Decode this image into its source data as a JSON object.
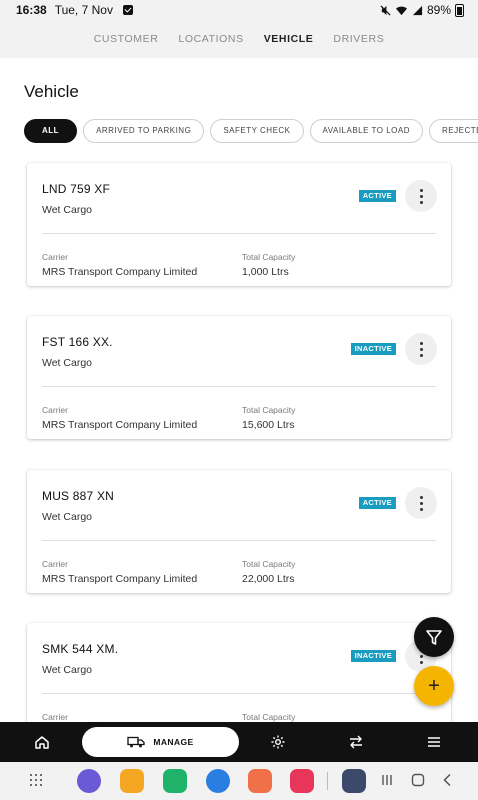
{
  "status_bar": {
    "time": "16:38",
    "date": "Tue, 7 Nov",
    "battery": "89%"
  },
  "top_tabs": [
    {
      "label": "CUSTOMER",
      "active": false
    },
    {
      "label": "LOCATIONS",
      "active": false
    },
    {
      "label": "VEHICLE",
      "active": true
    },
    {
      "label": "DRIVERS",
      "active": false
    }
  ],
  "page_title": "Vehicle",
  "filters": [
    {
      "label": "ALL",
      "active": true
    },
    {
      "label": "ARRIVED TO PARKING",
      "active": false
    },
    {
      "label": "SAFETY CHECK",
      "active": false
    },
    {
      "label": "AVAILABLE TO LOAD",
      "active": false
    },
    {
      "label": "REJECTED",
      "active": false
    }
  ],
  "vehicles": [
    {
      "reg": "LND 759 XF",
      "cargo": "Wet Cargo",
      "status": "ACTIVE",
      "carrier_label": "Carrier",
      "carrier": "MRS Transport Company Limited",
      "capacity_label": "Total Capacity",
      "capacity": "1,000 Ltrs"
    },
    {
      "reg": "FST 166 XX.",
      "cargo": "Wet Cargo",
      "status": "INACTIVE",
      "carrier_label": "Carrier",
      "carrier": "MRS Transport Company Limited",
      "capacity_label": "Total Capacity",
      "capacity": "15,600 Ltrs"
    },
    {
      "reg": "MUS 887 XN",
      "cargo": "Wet Cargo",
      "status": "ACTIVE",
      "carrier_label": "Carrier",
      "carrier": "MRS Transport Company Limited",
      "capacity_label": "Total Capacity",
      "capacity": "22,000 Ltrs"
    },
    {
      "reg": "SMK 544 XM.",
      "cargo": "Wet Cargo",
      "status": "INACTIVE",
      "carrier_label": "Carrier",
      "carrier": "",
      "capacity_label": "Total Capacity",
      "capacity": ""
    }
  ],
  "bottom_nav": {
    "manage_label": "MANAGE",
    "icons": [
      "home-icon",
      "truck-icon",
      "gear-icon",
      "swap-arrows-icon",
      "menu-icon"
    ]
  },
  "fabs": {
    "filter_icon": "filter-icon",
    "add_symbol": "+"
  },
  "colors": {
    "badge": "#1a9bc0",
    "fab_add": "#f5b400",
    "nav_bg": "#111111"
  },
  "dock_apps": [
    "internet-app-icon",
    "files-app-icon",
    "phone-app-icon",
    "messages-app-icon",
    "contacts-app-icon",
    "camera-app-icon",
    "settings-app-icon"
  ]
}
